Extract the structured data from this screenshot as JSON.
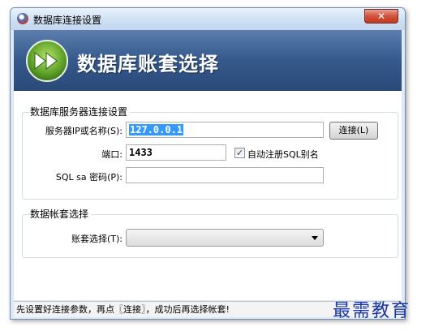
{
  "window": {
    "title": "数据库连接设置",
    "close_label": "✕"
  },
  "banner": {
    "title": "数据库账套选择"
  },
  "server_group": {
    "title": "数据库服务器连接设置",
    "server_label": "服务器IP或名称(S):",
    "server_value": "127.0.0.1",
    "connect_button": "连接(L)",
    "port_label": "端口:",
    "port_value": "1433",
    "alias_checkbox_label": "自动注册SQL别名",
    "alias_checked": true,
    "password_label": "SQL sa 密码(P):",
    "password_value": ""
  },
  "account_group": {
    "title": "数据帐套选择",
    "account_label": "账套选择(T):",
    "account_value": ""
  },
  "status": {
    "text": "先设置好连接参数，再点〖连接〗，成功后再选择帐套!"
  },
  "watermark": {
    "text": "最需教育"
  }
}
